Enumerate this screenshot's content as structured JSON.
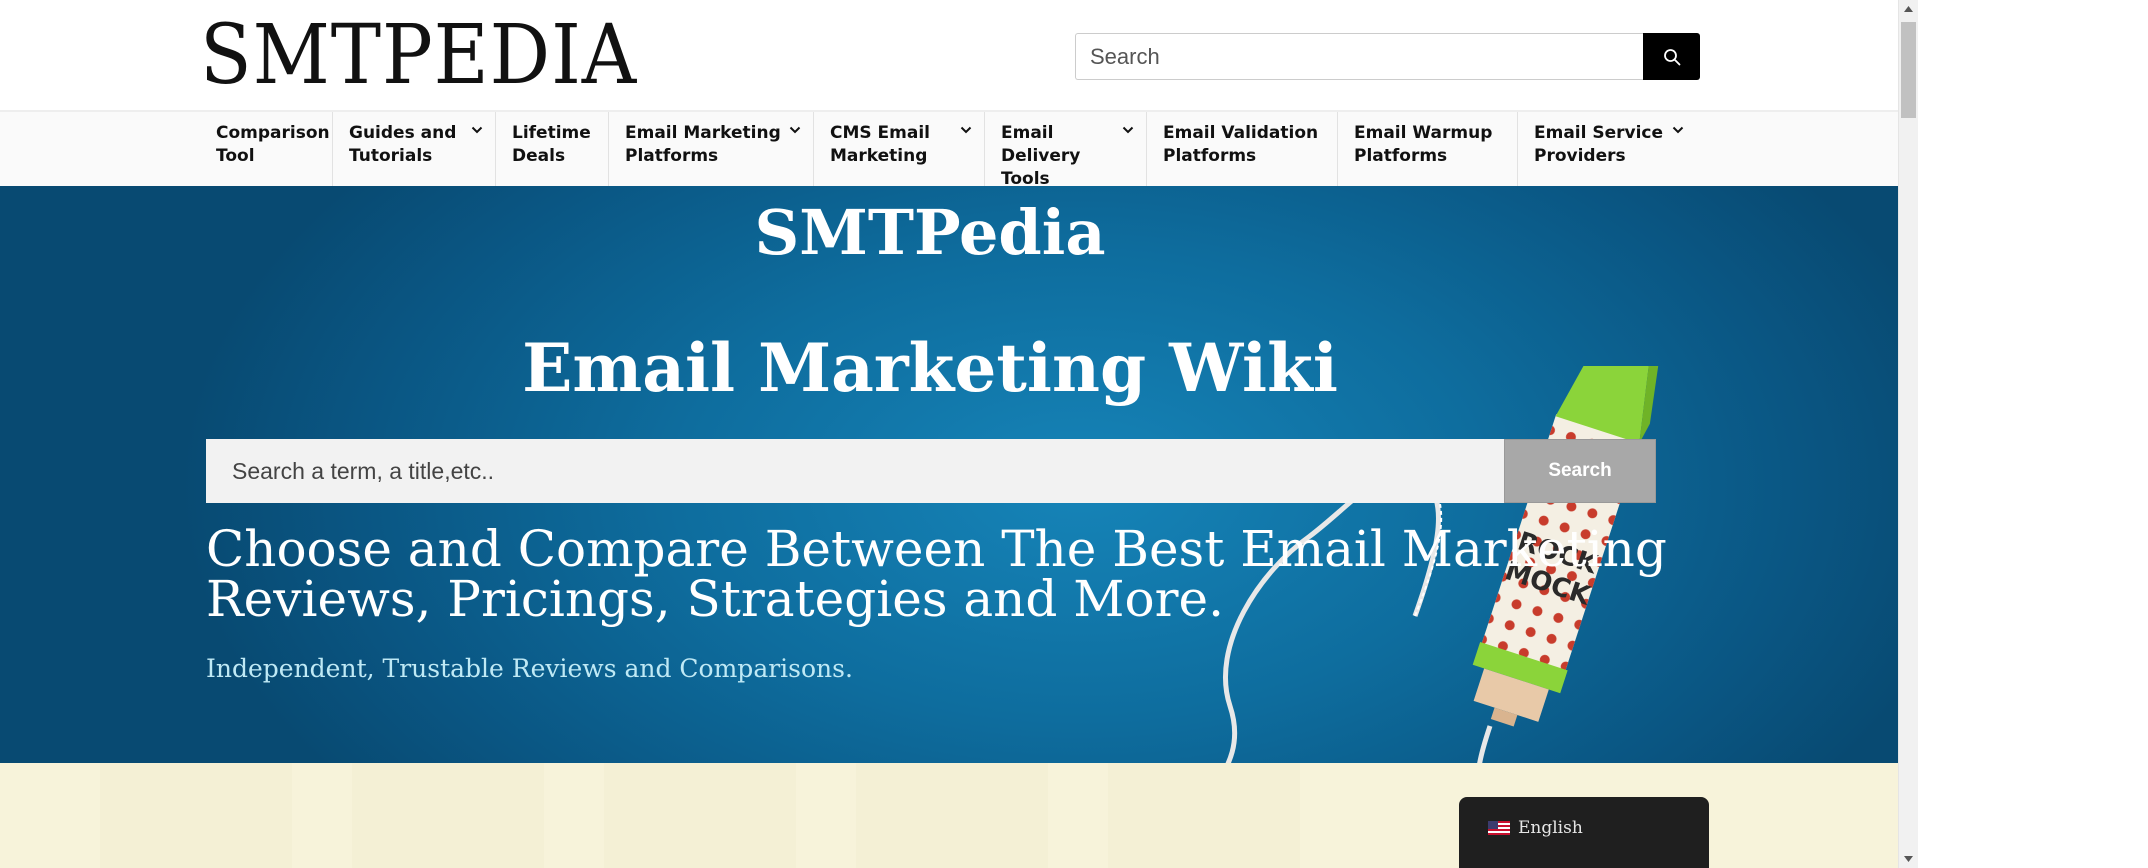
{
  "header": {
    "logo": "SMTPEDIA",
    "search_placeholder": "Search",
    "search_icon": "search-icon"
  },
  "nav": {
    "items": [
      {
        "line1": "Comparison",
        "line2": "Tool",
        "has_dropdown": false
      },
      {
        "line1": "Guides and",
        "line2": "Tutorials",
        "has_dropdown": true
      },
      {
        "line1": "Lifetime",
        "line2": "Deals",
        "has_dropdown": false
      },
      {
        "line1": "Email Marketing",
        "line2": "Platforms",
        "has_dropdown": true
      },
      {
        "line1": "CMS Email",
        "line2": "Marketing",
        "has_dropdown": true
      },
      {
        "line1": "Email",
        "line2": "Delivery Tools",
        "has_dropdown": true
      },
      {
        "line1": "Email Validation",
        "line2": "Platforms",
        "has_dropdown": false
      },
      {
        "line1": "Email Warmup",
        "line2": "Platforms",
        "has_dropdown": false
      },
      {
        "line1": "Email Service",
        "line2": "Providers",
        "has_dropdown": true
      }
    ],
    "dropdown_icon": "chevron-down-icon"
  },
  "hero": {
    "title": "SMTPedia",
    "subtitle": "Email Marketing Wiki",
    "search_placeholder": "Search a term, a title,etc..",
    "search_button": "Search",
    "headline": "Choose and Compare Between The Best Email Marketing Reviews, Pricings, Strategies and More.",
    "tagline": "Independent, Trustable Reviews and Comparisons.",
    "rocket_label_line1": "ROCK",
    "rocket_label_line2": "MOCK"
  },
  "language": {
    "label": "English",
    "flag_icon": "us-flag-icon"
  },
  "colors": {
    "hero_blue": "#0e6d9e",
    "search_button_gray": "#a8a8a8",
    "cream": "#f7f3da",
    "rocket_green": "#8bd43a",
    "polka_red": "#c83c2c"
  }
}
